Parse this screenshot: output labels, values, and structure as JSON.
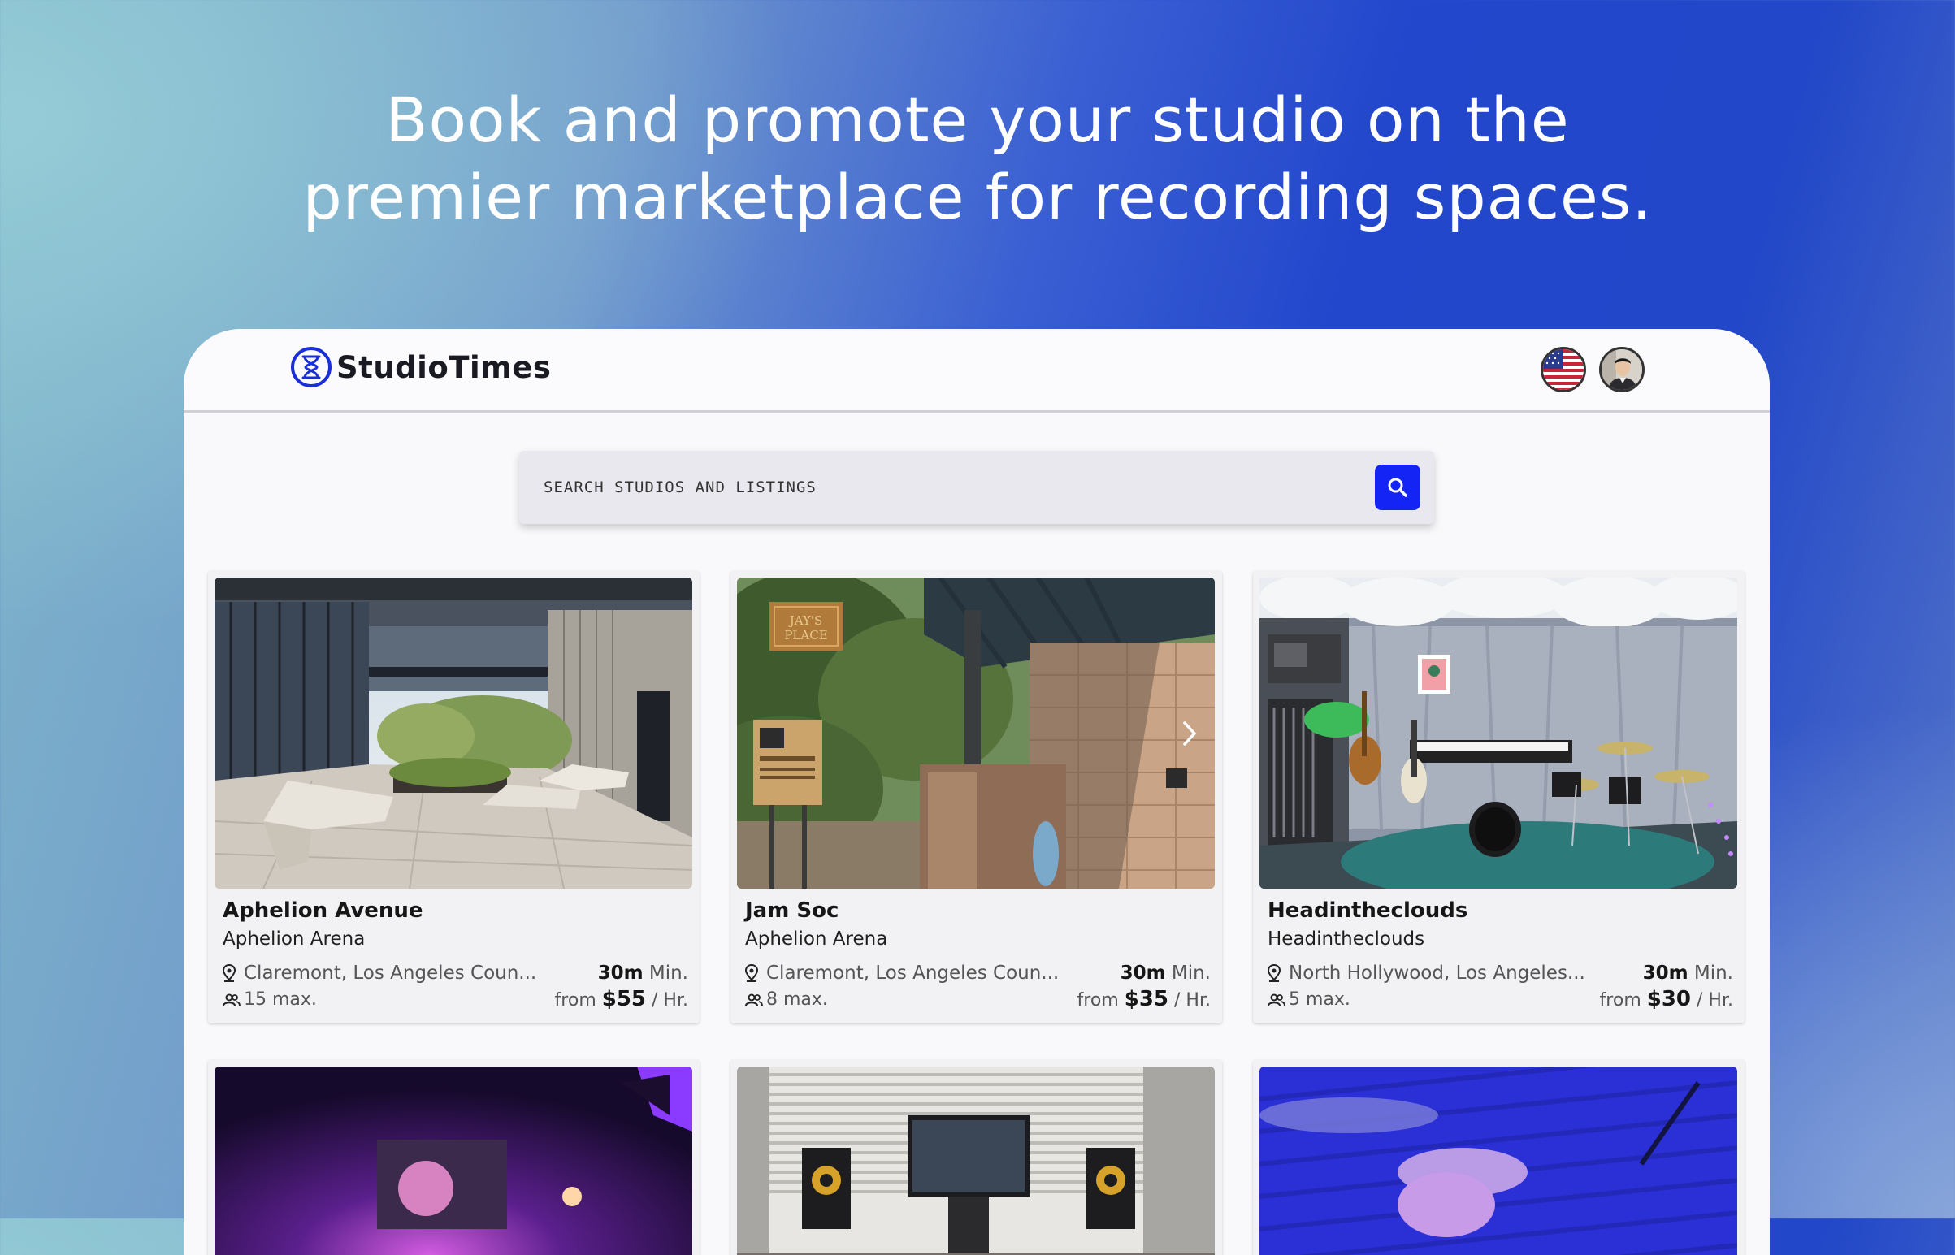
{
  "headline": {
    "line1": "Book and promote your studio on the",
    "line2": "premier marketplace for recording spaces."
  },
  "app": {
    "brand": "StudioTimes",
    "logo_icon": "hourglass-icon",
    "language_icon": "us-flag-icon",
    "profile_icon": "user-avatar"
  },
  "search": {
    "placeholder": "SEARCH STUDIOS AND LISTINGS",
    "value": "",
    "button_icon": "search-icon",
    "accent": "#1424f5"
  },
  "listings": [
    {
      "title": "Aphelion Avenue",
      "studio": "Aphelion Arena",
      "location": "Claremont, Los Angeles Coun...",
      "min_value": "30m",
      "min_unit": "Min.",
      "capacity": "15 max.",
      "price_prefix": "from",
      "price": "$55",
      "price_unit": "/ Hr."
    },
    {
      "title": "Jam Soc",
      "studio": "Aphelion Arena",
      "location": "Claremont, Los Angeles Coun...",
      "min_value": "30m",
      "min_unit": "Min.",
      "capacity": "8 max.",
      "price_prefix": "from",
      "price": "$35",
      "price_unit": "/ Hr.",
      "sign_text": "JAY'S PLACE"
    },
    {
      "title": "Headintheclouds",
      "studio": "Headintheclouds",
      "location": "North Hollywood, Los Angeles...",
      "min_value": "30m",
      "min_unit": "Min.",
      "capacity": "5 max.",
      "price_prefix": "from",
      "price": "$30",
      "price_unit": "/ Hr."
    },
    {
      "title": "",
      "studio": ""
    },
    {
      "title": "",
      "studio": ""
    },
    {
      "title": "",
      "studio": ""
    }
  ]
}
